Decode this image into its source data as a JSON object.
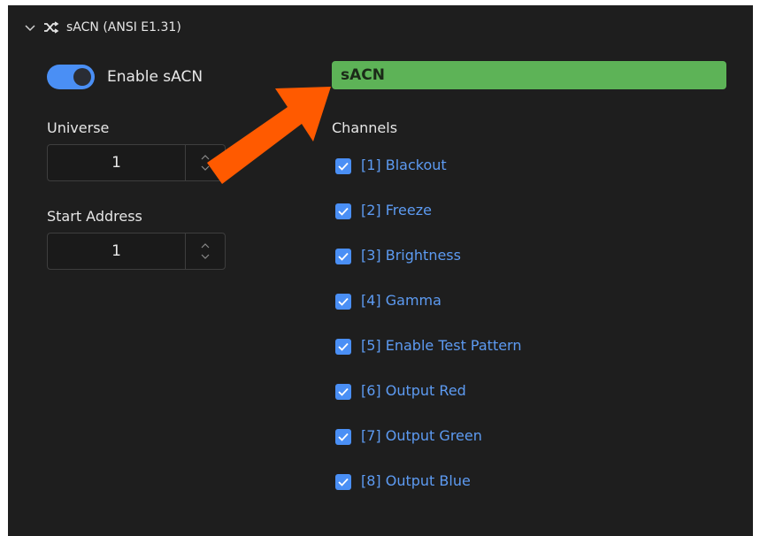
{
  "section": {
    "title": "sACN (ANSI E1.31)",
    "chevron_icon": "chevron-down-icon",
    "shuffle_icon": "shuffle-icon"
  },
  "enable": {
    "label": "Enable sACN",
    "checked": true
  },
  "universe": {
    "label": "Universe",
    "value": "1"
  },
  "start_address": {
    "label": "Start Address",
    "value": "1"
  },
  "name_field": {
    "value": "sACN",
    "color": "#5db357"
  },
  "channels": {
    "heading": "Channels",
    "items": [
      {
        "label": "[1] Blackout",
        "checked": true
      },
      {
        "label": "[2] Freeze",
        "checked": true
      },
      {
        "label": "[3] Brightness",
        "checked": true
      },
      {
        "label": "[4] Gamma",
        "checked": true
      },
      {
        "label": "[5] Enable Test Pattern",
        "checked": true
      },
      {
        "label": "[6] Output Red",
        "checked": true
      },
      {
        "label": "[7] Output Green",
        "checked": true
      },
      {
        "label": "[8] Output Blue",
        "checked": true
      }
    ]
  },
  "colors": {
    "accent": "#4a8ff5",
    "annotation_arrow": "#ff5a00",
    "panel_bg": "#1e1e1e"
  }
}
